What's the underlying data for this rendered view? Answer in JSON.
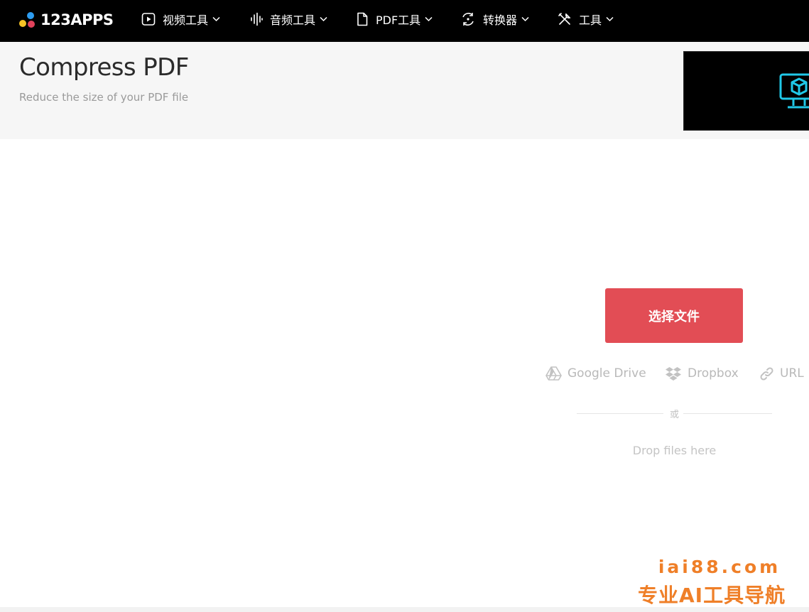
{
  "brand": {
    "logo_text": "123APPS",
    "dot_colors": [
      "#2d9cf0",
      "#f7c325",
      "#e2425b"
    ]
  },
  "nav": {
    "items": [
      {
        "label": "视频工具",
        "icon": "play-circle-icon"
      },
      {
        "label": "音频工具",
        "icon": "audio-wave-icon"
      },
      {
        "label": "PDF工具",
        "icon": "document-icon"
      },
      {
        "label": "转换器",
        "icon": "convert-cycle-icon"
      },
      {
        "label": "工具",
        "icon": "tools-icon"
      }
    ]
  },
  "header": {
    "title": "Compress PDF",
    "subtitle": "Reduce the size of your PDF file"
  },
  "ad": {
    "icon": "monitor-cube-icon",
    "accent": "#20c8e8"
  },
  "uploader": {
    "choose_button_label": "选择文件",
    "button_color": "#e24d55",
    "sources": [
      {
        "label": "Google Drive",
        "icon": "google-drive-icon"
      },
      {
        "label": "Dropbox",
        "icon": "dropbox-icon"
      },
      {
        "label": "URL",
        "icon": "link-icon"
      }
    ],
    "or_label": "或",
    "drop_label": "Drop files here"
  },
  "watermark": {
    "domain": "iai88.com",
    "slogan": "专业AI工具导航",
    "color": "#ef7f28"
  }
}
